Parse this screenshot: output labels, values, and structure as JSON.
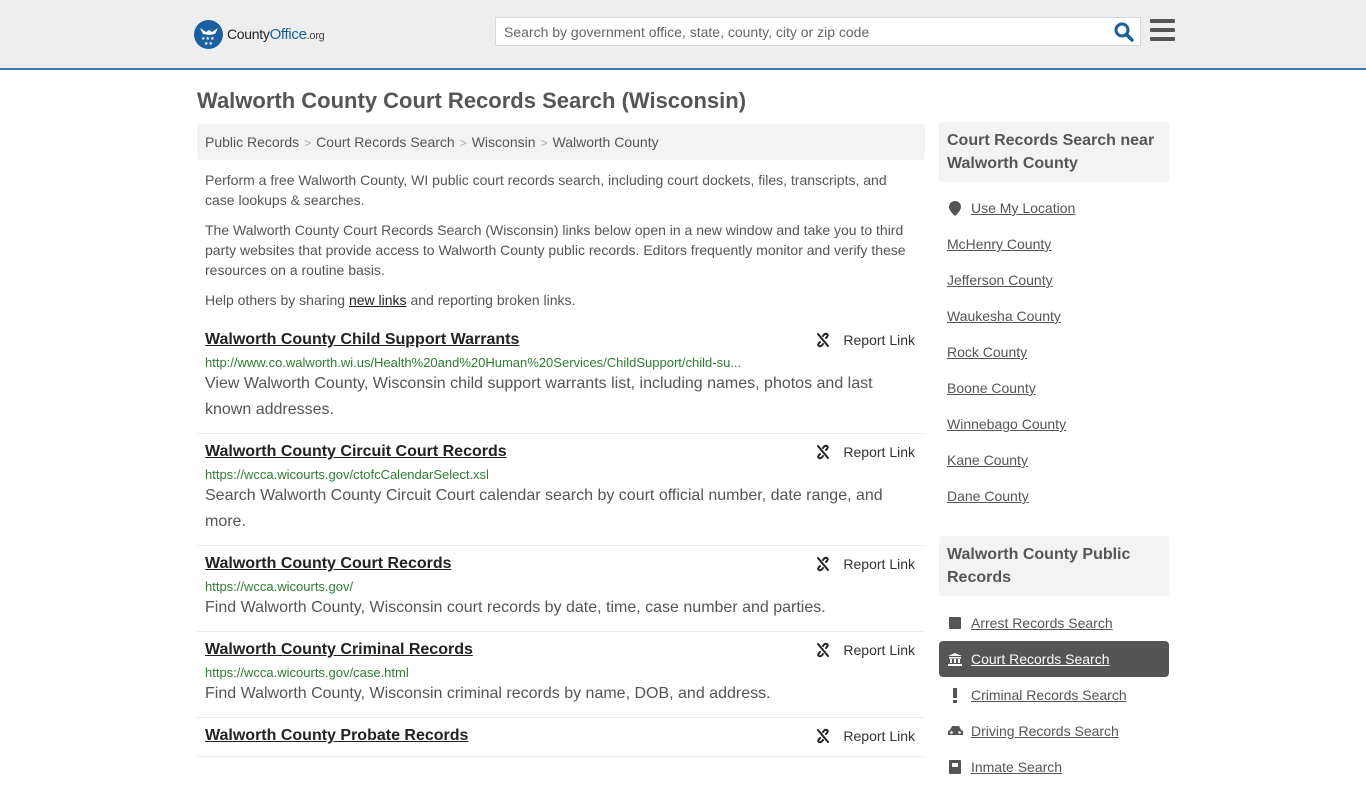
{
  "header": {
    "logo": {
      "county": "County",
      "office": "Office",
      "org": ".org"
    },
    "search_placeholder": "Search by government office, state, county, city or zip code",
    "search_value": "",
    "icons": {
      "search": "search-icon",
      "menu": "hamburger-menu-icon"
    }
  },
  "page_title": "Walworth County Court Records Search (Wisconsin)",
  "breadcrumb": [
    "Public Records",
    "Court Records Search",
    "Wisconsin",
    "Walworth County"
  ],
  "breadcrumb_separator": ">",
  "intro": {
    "p1": "Perform a free Walworth County, WI public court records search, including court dockets, files, transcripts, and case lookups & searches.",
    "p2": "The Walworth County Court Records Search (Wisconsin) links below open in a new window and take you to third party websites that provide access to Walworth County public records. Editors frequently monitor and verify these resources on a routine basis.",
    "p3_before": "Help others by sharing ",
    "p3_link": "new links",
    "p3_after": " and reporting broken links."
  },
  "report_label": "Report Link",
  "links": [
    {
      "title": "Walworth County Child Support Warrants",
      "url": "http://www.co.walworth.wi.us/Health%20and%20Human%20Services/ChildSupport/child-su...",
      "desc": "View Walworth County, Wisconsin child support warrants list, including names, photos and last known addresses."
    },
    {
      "title": "Walworth County Circuit Court Records",
      "url": "https://wcca.wicourts.gov/ctofcCalendarSelect.xsl",
      "desc": "Search Walworth County Circuit Court calendar search by court official number, date range, and more."
    },
    {
      "title": "Walworth County Court Records",
      "url": "https://wcca.wicourts.gov/",
      "desc": "Find Walworth County, Wisconsin court records by date, time, case number and parties."
    },
    {
      "title": "Walworth County Criminal Records",
      "url": "https://wcca.wicourts.gov/case.html",
      "desc": "Find Walworth County, Wisconsin criminal records by name, DOB, and address."
    },
    {
      "title": "Walworth County Probate Records",
      "url": "",
      "desc": ""
    }
  ],
  "sidebar": {
    "nearby_title": "Court Records Search near Walworth County",
    "use_location": "Use My Location",
    "nearby": [
      "McHenry County",
      "Jefferson County",
      "Waukesha County",
      "Rock County",
      "Boone County",
      "Winnebago County",
      "Kane County",
      "Dane County"
    ],
    "public_title": "Walworth County Public Records",
    "public_records": [
      {
        "label": "Arrest Records Search",
        "icon": "square-icon",
        "active": false
      },
      {
        "label": "Court Records Search",
        "icon": "courthouse-icon",
        "active": true
      },
      {
        "label": "Criminal Records Search",
        "icon": "exclamation-icon",
        "active": false
      },
      {
        "label": "Driving Records Search",
        "icon": "car-icon",
        "active": false
      },
      {
        "label": "Inmate Search",
        "icon": "inmate-icon",
        "active": false
      }
    ]
  },
  "colors": {
    "accent": "#1a5fa0",
    "topbar_border": "#3a7bab",
    "url_green": "#2e7d32",
    "active_bg": "#555555"
  }
}
